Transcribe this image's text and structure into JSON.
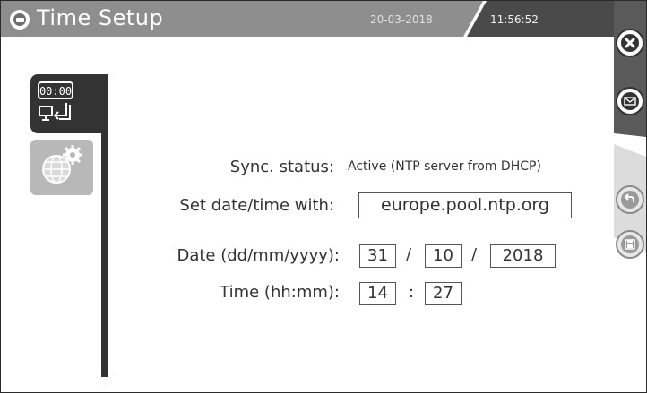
{
  "header": {
    "title": "Time Setup",
    "date": "20-03-2018",
    "time": "11:56:52"
  },
  "sidebar": {
    "items": [
      {
        "name": "time-setup-tab",
        "clock_text": "00:00",
        "active": true
      },
      {
        "name": "network-settings-tab",
        "active": false
      }
    ]
  },
  "form": {
    "sync_label": "Sync. status:",
    "sync_value": "Active (NTP server from DHCP)",
    "set_with_label": "Set date/time with:",
    "ntp_server": "europe.pool.ntp.org",
    "date_label": "Date (dd/mm/yyyy):",
    "day": "31",
    "month": "10",
    "year": "2018",
    "date_sep": "/",
    "time_label": "Time (hh:mm):",
    "hour": "14",
    "minute": "27",
    "time_sep": ":"
  },
  "actions": {
    "close": "close-icon",
    "email": "envelope-icon",
    "undo": "undo-icon",
    "save": "floppy-disk-icon"
  },
  "colors": {
    "header": "#8e8e8e",
    "header_dark": "#4a4a4a",
    "sidebar_dark": "#333333",
    "tab_inactive": "#b8b8b8"
  }
}
